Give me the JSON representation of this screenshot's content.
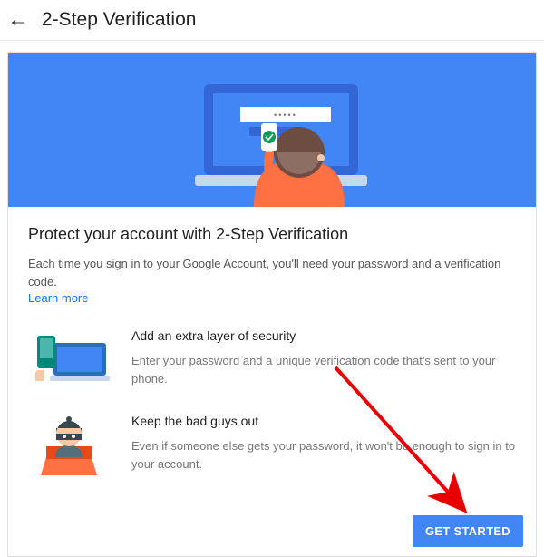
{
  "header": {
    "title": "2-Step Verification"
  },
  "main": {
    "section_title": "Protect your account with 2-Step Verification",
    "section_desc": "Each time you sign in to your Google Account, you'll need your password and a verification code.",
    "learn_more": "Learn more",
    "features": [
      {
        "heading": "Add an extra layer of security",
        "desc": "Enter your password and a unique verification code that's sent to your phone."
      },
      {
        "heading": "Keep the bad guys out",
        "desc": "Even if someone else gets your password, it won't be enough to sign in to your account."
      }
    ],
    "cta_label": "GET STARTED"
  }
}
